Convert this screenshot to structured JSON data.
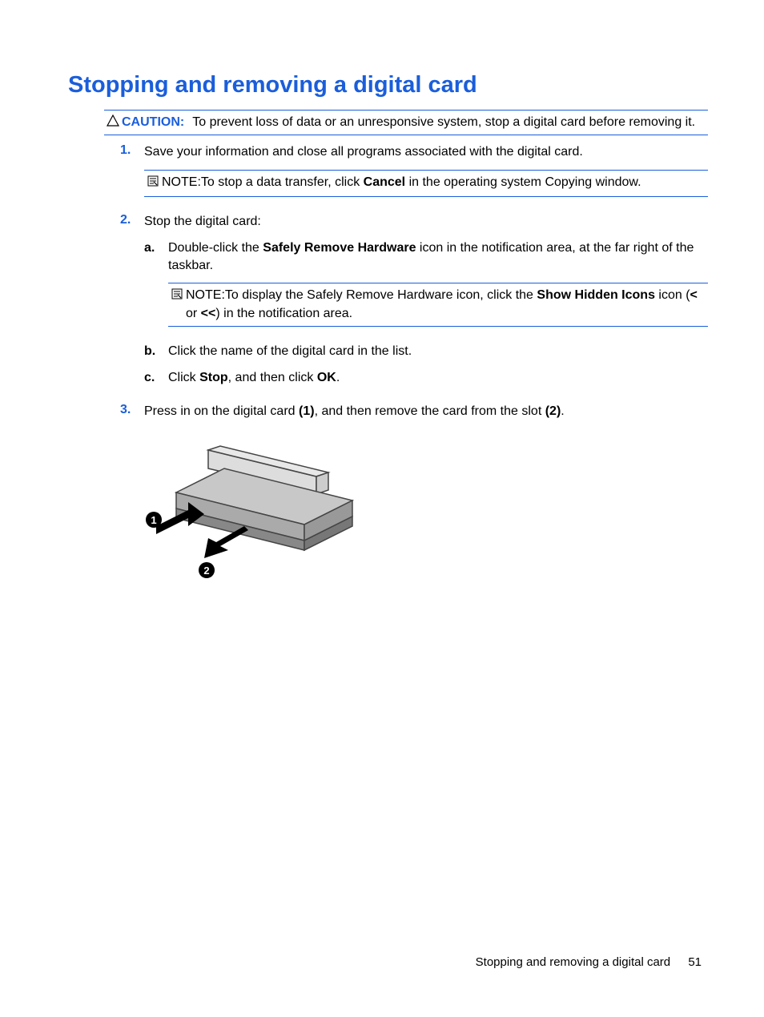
{
  "title": "Stopping and removing a digital card",
  "caution": {
    "label": "CAUTION:",
    "text": "To prevent loss of data or an unresponsive system, stop a digital card before removing it."
  },
  "steps": {
    "s1": {
      "num": "1.",
      "text": "Save your information and close all programs associated with the digital card.",
      "note_label": "NOTE:",
      "note_before": "To stop a data transfer, click ",
      "note_bold": "Cancel",
      "note_after": " in the operating system Copying window."
    },
    "s2": {
      "num": "2.",
      "text": "Stop the digital card:",
      "a": {
        "letter": "a.",
        "before": "Double-click the ",
        "bold": "Safely Remove Hardware",
        "after": " icon in the notification area, at the far right of the taskbar.",
        "note_label": "NOTE:",
        "note_before": "To display the Safely Remove Hardware icon, click the ",
        "note_bold": "Show Hidden Icons",
        "note_after1": " icon (",
        "note_lt": "<",
        "note_or": " or ",
        "note_ltlt": "<<",
        "note_after2": ") in the notification area."
      },
      "b": {
        "letter": "b.",
        "text": "Click the name of the digital card in the list."
      },
      "c": {
        "letter": "c.",
        "before": "Click ",
        "bold1": "Stop",
        "mid": ", and then click ",
        "bold2": "OK",
        "after": "."
      }
    },
    "s3": {
      "num": "3.",
      "before": "Press in on the digital card ",
      "bold1": "(1)",
      "mid": ", and then remove the card from the slot ",
      "bold2": "(2)",
      "after": "."
    }
  },
  "diagram": {
    "label1": "1",
    "label2": "2"
  },
  "footer": {
    "text": "Stopping and removing a digital card",
    "page": "51"
  }
}
